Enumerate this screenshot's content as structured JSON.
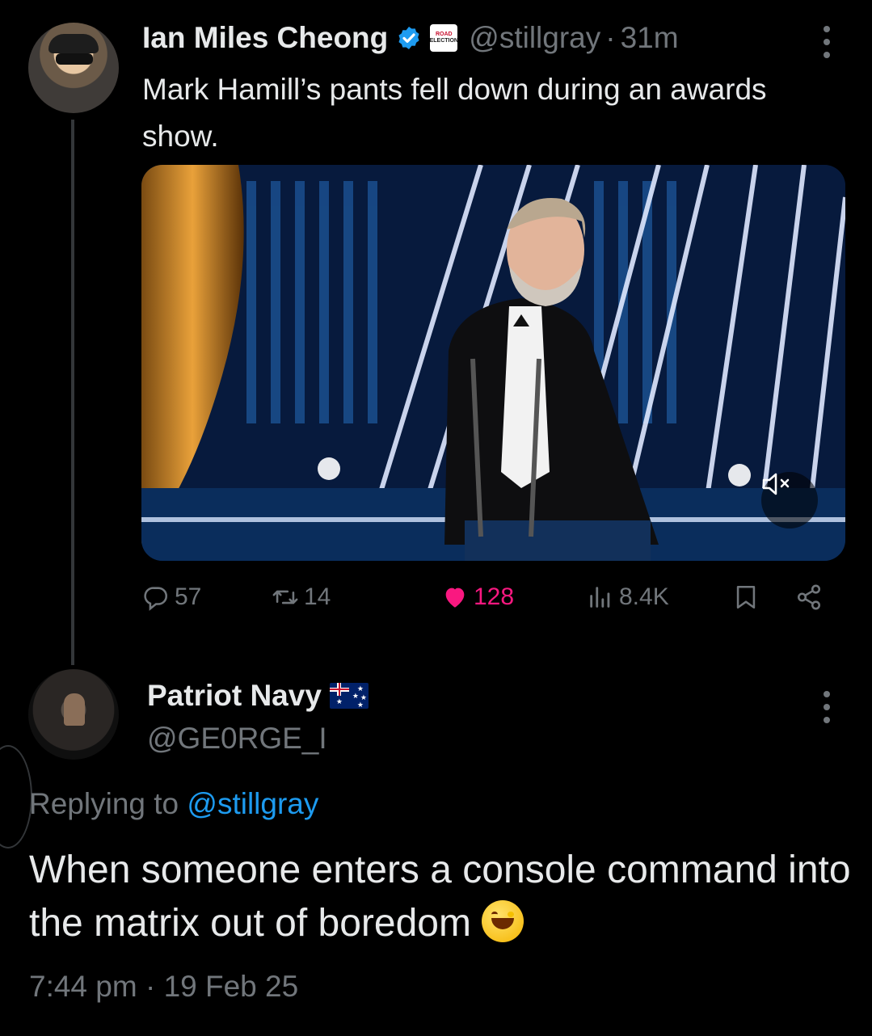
{
  "tweet": {
    "author_name": "Ian Miles Cheong",
    "badge_text": [
      "ROAD",
      "ELECTION"
    ],
    "handle": "@stillgray",
    "separator": "·",
    "time_ago": "31m",
    "text": "Mark Hamill’s pants fell down during an awards show.",
    "stats": {
      "replies": "57",
      "retweets": "14",
      "likes": "128",
      "views": "8.4K"
    },
    "colors": {
      "like": "#f91880",
      "verified": "#1d9bf0"
    }
  },
  "reply": {
    "author_name": "Patriot Navy",
    "flag": "australia-flag",
    "handle": "@GE0RGE_I",
    "replying_prefix": "Replying to",
    "replying_to": "@stillgray",
    "text": "When someone enters a console command into the matrix out of boredom",
    "emoji": "grinning-face-with-smiling-eyes",
    "timestamp": "7:44 pm · 19 Feb 25"
  }
}
